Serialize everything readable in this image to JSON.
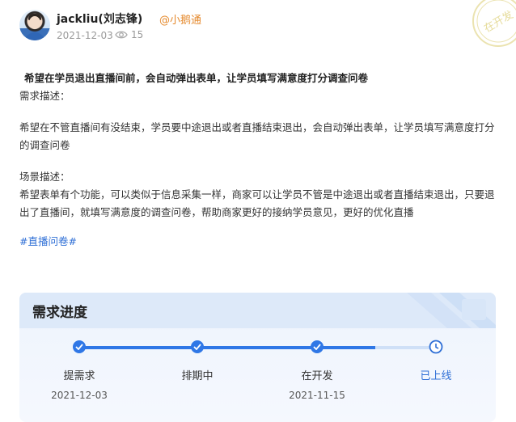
{
  "post": {
    "author": "jackliu(刘志锋)",
    "org": "@小鹅通",
    "date": "2021-12-03",
    "views": "15",
    "stamp": "在开发"
  },
  "content": {
    "title": "希望在学员退出直播间前，会自动弹出表单，让学员填写满意度打分调查问卷",
    "req_heading": "需求描述：",
    "req_body": "希望在不管直播间有没结束，学员要中途退出或者直播结束退出，会自动弹出表单，让学员填写满意度打分的调查问卷",
    "scene_heading": "场景描述：",
    "scene_body": "希望表单有个功能，可以类似于信息采集一样，商家可以让学员不管是中途退出或者直播结束退出，只要退出了直播间，就填写满意度的调查问卷，帮助商家更好的接纳学员意见，更好的优化直播",
    "tag": "#直播问卷#"
  },
  "progress": {
    "title": "需求进度",
    "steps": [
      {
        "label": "提需求",
        "date": "2021-12-03",
        "state": "done"
      },
      {
        "label": "排期中",
        "date": "",
        "state": "done"
      },
      {
        "label": "在开发",
        "date": "2021-11-15",
        "state": "done"
      },
      {
        "label": "已上线",
        "date": "",
        "state": "pending"
      }
    ]
  },
  "colors": {
    "accent": "#2f77e6",
    "org": "#e58a2e",
    "stamp": "#e9dfa0"
  },
  "icons": {
    "views": "eye-icon",
    "done_step": "check-icon",
    "pending_step": "clock-icon"
  }
}
